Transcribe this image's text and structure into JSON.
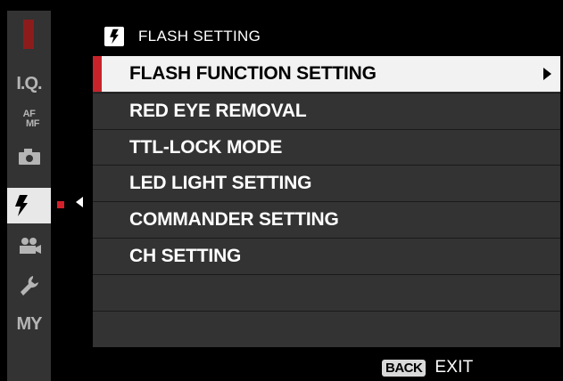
{
  "header": {
    "title": "FLASH SETTING",
    "icon": "flash-icon"
  },
  "sidebar": {
    "items": [
      {
        "label": "I.Q.",
        "icon": "image-quality-label"
      },
      {
        "label": "AF",
        "sublabel": "MF",
        "icon": "af-mf-label"
      },
      {
        "label": "",
        "icon": "camera-icon"
      },
      {
        "label": "",
        "icon": "flash-icon",
        "active": true
      },
      {
        "label": "",
        "icon": "movie-camera-icon"
      },
      {
        "label": "",
        "icon": "wrench-icon"
      },
      {
        "label": "MY",
        "icon": "my-menu-label"
      }
    ]
  },
  "menu": {
    "items": [
      {
        "label": "FLASH FUNCTION SETTING",
        "selected": true,
        "has_submenu": true
      },
      {
        "label": "RED EYE REMOVAL"
      },
      {
        "label": "TTL-LOCK MODE"
      },
      {
        "label": "LED LIGHT SETTING"
      },
      {
        "label": "COMMANDER SETTING"
      },
      {
        "label": "CH SETTING"
      },
      {
        "label": ""
      },
      {
        "label": ""
      }
    ]
  },
  "footer": {
    "back_label": "BACK",
    "exit_label": "EXIT"
  },
  "colors": {
    "accent_red": "#c8232b",
    "panel_gray": "#333333",
    "selected_row": "#f2f2f2"
  }
}
